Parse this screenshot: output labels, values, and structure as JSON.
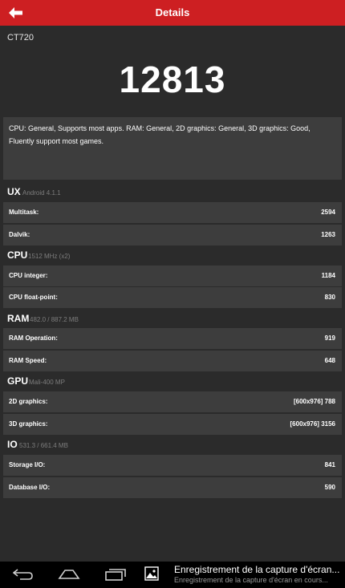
{
  "header": {
    "title": "Details"
  },
  "device": {
    "name": "CT720"
  },
  "score": {
    "total": "12813"
  },
  "summary": {
    "text": "CPU: General, Supports most apps. RAM: General, 2D graphics: General, 3D graphics: Good, Fluently support most games."
  },
  "sections": [
    {
      "title": "UX",
      "subtitle": "Android 4.1.1",
      "rows": [
        {
          "label": "Multitask:",
          "value": "2594"
        },
        {
          "label": "Dalvik:",
          "value": "1263"
        }
      ]
    },
    {
      "title": "CPU",
      "subtitle": "1512 MHz (x2)",
      "rows": [
        {
          "label": "CPU integer:",
          "value": "1184"
        },
        {
          "label": "CPU float-point:",
          "value": "830"
        }
      ]
    },
    {
      "title": "RAM",
      "subtitle": "482.0 / 887.2 MB",
      "rows": [
        {
          "label": "RAM Operation:",
          "value": "919"
        },
        {
          "label": "RAM Speed:",
          "value": "648"
        }
      ]
    },
    {
      "title": "GPU",
      "subtitle": "Mali-400 MP",
      "rows": [
        {
          "label": "2D graphics:",
          "value": "[600x976] 788"
        },
        {
          "label": "3D graphics:",
          "value": "[600x976] 3156"
        }
      ]
    },
    {
      "title": "IO",
      "subtitle": "531.3 / 661.4 MB",
      "rows": [
        {
          "label": "Storage I/O:",
          "value": "841"
        },
        {
          "label": "Database I/O:",
          "value": "590"
        }
      ]
    }
  ],
  "notification": {
    "title": "Enregistrement de la capture d'écran...",
    "subtitle": "Enregistrement de la capture d'écran en cours..."
  },
  "icons": {
    "back": "back-arrow-icon",
    "nav_back": "nav-back-icon",
    "nav_home": "nav-home-icon",
    "nav_recents": "nav-recents-icon",
    "notification": "image-icon"
  },
  "colors": {
    "header": "#cd1f22",
    "background": "#2b2b2b",
    "card": "#3d3d3d",
    "subtitle": "#7d7d7d",
    "navbar": "#000000"
  }
}
